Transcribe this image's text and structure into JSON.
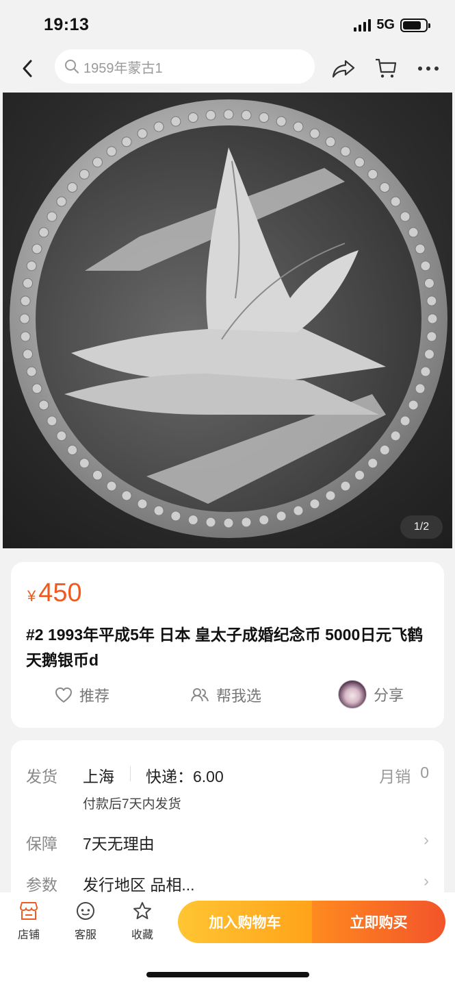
{
  "status_bar": {
    "time": "19:13",
    "network": "5G"
  },
  "search": {
    "query": "1959年蒙古1"
  },
  "gallery": {
    "counter": "1/2"
  },
  "product": {
    "currency": "¥",
    "price": "450",
    "title": "#2 1993年平成5年 日本 皇太子成婚纪念币 5000日元飞鹤天鹅银币d"
  },
  "actions": {
    "recommend": "推荐",
    "help_choose": "帮我选",
    "share": "分享"
  },
  "shipping": {
    "label": "发货",
    "origin": "上海",
    "express": "快递：6.00",
    "sales_label": "月销",
    "sales_value": "0",
    "note": "付款后7天内发货"
  },
  "guarantee": {
    "label": "保障",
    "value": "7天无理由"
  },
  "params": {
    "label": "参数",
    "value": "发行地区 品相..."
  },
  "bottom_bar": {
    "shop": "店铺",
    "service": "客服",
    "favorite": "收藏",
    "add_to_cart": "加入购物车",
    "buy_now": "立即购买"
  },
  "colors": {
    "price": "#f05a1e",
    "cart_button": "#ffb326",
    "buy_button": "#f2542a",
    "shop_icon": "#f05a1e"
  },
  "icons": [
    "back-icon",
    "search-icon",
    "share-icon",
    "cart-icon",
    "more-icon",
    "heart-icon",
    "people-icon",
    "shop-icon",
    "chat-icon",
    "star-icon"
  ]
}
